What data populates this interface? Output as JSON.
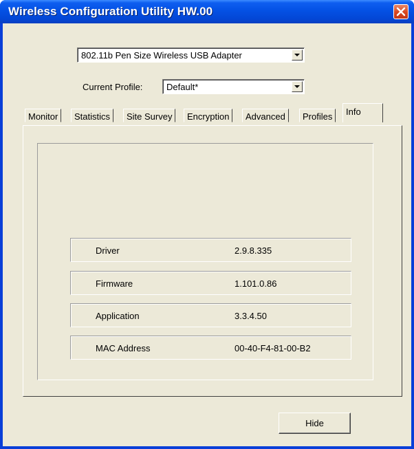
{
  "window": {
    "title": "Wireless Configuration Utility HW.00"
  },
  "adapter": {
    "selected": "802.11b Pen Size Wireless USB Adapter"
  },
  "profile": {
    "label": "Current Profile:",
    "selected": "Default*"
  },
  "tabs": [
    {
      "label": "Monitor"
    },
    {
      "label": "Statistics"
    },
    {
      "label": "Site Survey"
    },
    {
      "label": "Encryption"
    },
    {
      "label": "Advanced"
    },
    {
      "label": "Profiles"
    },
    {
      "label": "Info"
    }
  ],
  "active_tab": "Info",
  "info": [
    {
      "key": "Driver",
      "value": "2.9.8.335"
    },
    {
      "key": "Firmware",
      "value": "1.101.0.86"
    },
    {
      "key": "Application",
      "value": "3.3.4.50"
    },
    {
      "key": "MAC Address",
      "value": "00-40-F4-81-00-B2"
    }
  ],
  "buttons": {
    "hide": "Hide"
  },
  "colors": {
    "titlebar": "#0451e4",
    "face": "#ece9d8",
    "close": "#d8451f"
  }
}
